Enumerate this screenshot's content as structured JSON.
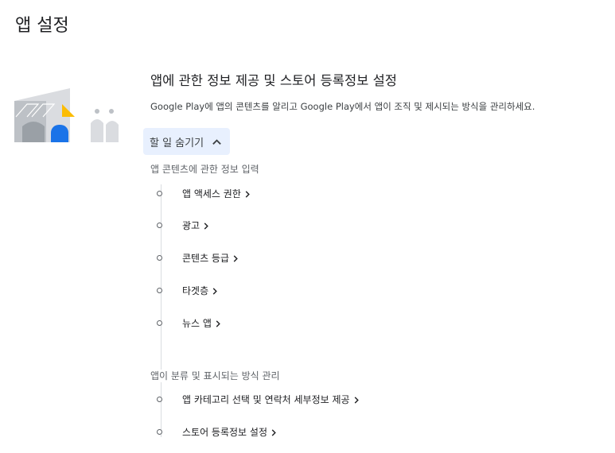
{
  "page": {
    "title": "앱 설정"
  },
  "section": {
    "title": "앱에 관한 정보 제공 및 스토어 등록정보 설정",
    "description": "Google Play에 앱의 콘텐츠를 알리고 Google Play에서 앱이 조직 및 제시되는 방식을 관리하세요."
  },
  "toggle": {
    "label": "할 일 숨기기",
    "icon": "chevron-up-icon"
  },
  "groups": [
    {
      "title": "앱 콘텐츠에 관한 정보 입력",
      "tasks": [
        {
          "label": "앱 액세스 권한"
        },
        {
          "label": "광고"
        },
        {
          "label": "콘텐츠 등급"
        },
        {
          "label": "타겟층"
        },
        {
          "label": "뉴스 앱"
        }
      ]
    },
    {
      "title": "앱이 분류 및 표시되는 방식 관리",
      "tasks": [
        {
          "label": "앱 카테고리 선택 및 연락처 세부정보 제공"
        },
        {
          "label": "스토어 등록정보 설정"
        }
      ]
    }
  ],
  "colors": {
    "accent_blue": "#1a73e8",
    "accent_yellow": "#fbbc04",
    "toggle_bg": "#e8f0fe",
    "illustration_gray": "#bdc1c6"
  }
}
